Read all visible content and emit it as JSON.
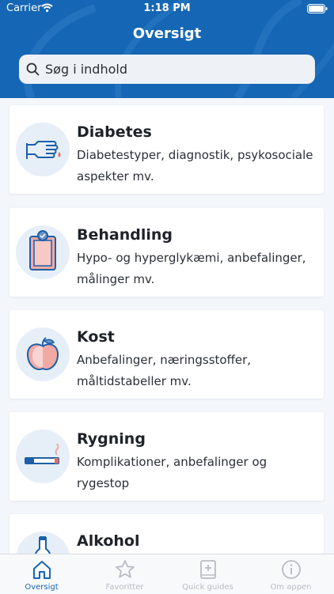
{
  "status_bar": {
    "carrier": "Carrier",
    "time": "1:18 PM"
  },
  "header": {
    "title": "Oversigt"
  },
  "search": {
    "placeholder": "Søg i indhold",
    "value": ""
  },
  "categories": [
    {
      "title": "Diabetes",
      "description": "Diabetestyper, diagnostik, psykosociale aspekter mv.",
      "icon": "pointing-hand-icon"
    },
    {
      "title": "Behandling",
      "description": "Hypo- og hyperglykæmi, anbefalinger, målinger mv.",
      "icon": "clipboard-icon"
    },
    {
      "title": "Kost",
      "description": "Anbefalinger, næringsstoffer, måltidstabeller mv.",
      "icon": "apple-icon"
    },
    {
      "title": "Rygning",
      "description": "Komplikationer, anbefalinger og rygestop",
      "icon": "cigarette-icon"
    },
    {
      "title": "Alkohol",
      "description": "",
      "icon": "bottle-icon"
    }
  ],
  "tabs": [
    {
      "label": "Oversigt",
      "icon": "home-icon",
      "active": true
    },
    {
      "label": "Favoritter",
      "icon": "star-icon",
      "active": false
    },
    {
      "label": "Quick guides",
      "icon": "guide-book-icon",
      "active": false
    },
    {
      "label": "Om appen",
      "icon": "info-icon",
      "active": false
    }
  ],
  "colors": {
    "primary": "#1566b4",
    "background": "#f3f6fa",
    "icon_bg": "#e6eff8",
    "accent_pink": "#f1a9a4",
    "tab_inactive": "#b7bcc4"
  }
}
